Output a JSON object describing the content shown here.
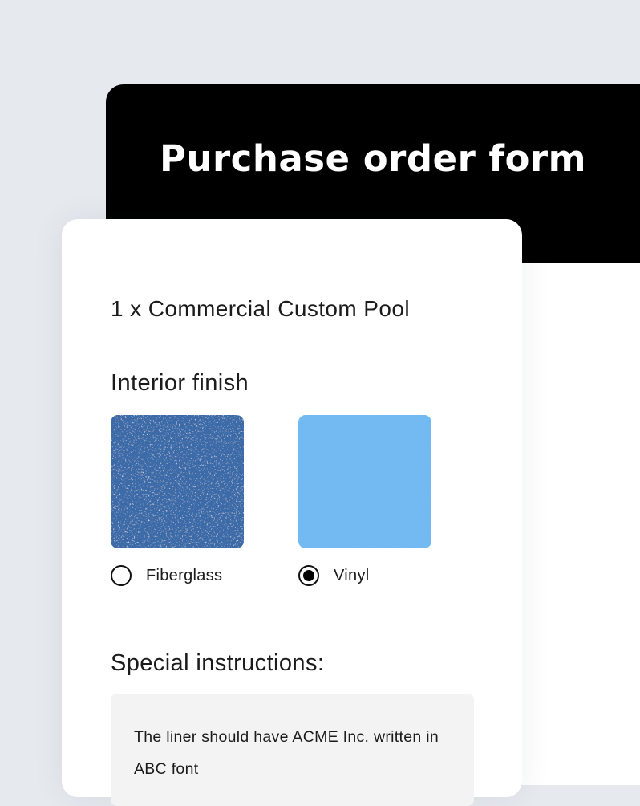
{
  "header": {
    "title": "Purchase order form"
  },
  "form": {
    "product_line": "1 x Commercial Custom Pool",
    "finish": {
      "heading": "Interior finish",
      "options": [
        {
          "label": "Fiberglass",
          "selected": false,
          "swatch_color": "#3a6aa8"
        },
        {
          "label": "Vinyl",
          "selected": true,
          "swatch_color": "#6cb8f2"
        }
      ]
    },
    "instructions": {
      "heading": "Special instructions:",
      "text": "The liner should have ACME Inc. written in ABC font"
    }
  },
  "colors": {
    "background": "#e6e9ee",
    "banner": "#000000",
    "card": "#ffffff",
    "textarea": "#f3f3f3"
  }
}
